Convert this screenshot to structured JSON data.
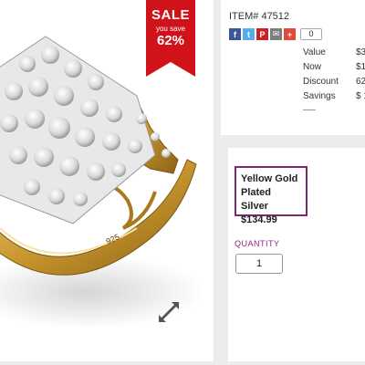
{
  "sale": {
    "title": "SALE",
    "subtitle": "you save",
    "percent": "62%",
    "ribbon_color": "#d0121b"
  },
  "icons": {
    "expand": "expand-arrows-icon",
    "share": [
      "facebook-icon",
      "twitter-icon",
      "pinterest-icon",
      "email-icon",
      "google-plus-icon"
    ]
  },
  "product": {
    "item_number": "ITEM# 47512",
    "share_count": "0",
    "share_letters": [
      "f",
      "t",
      "P",
      "✉",
      "+"
    ],
    "share_colors": [
      "#3b5998",
      "#55acee",
      "#cb2027",
      "#7d7d7d",
      "#dd4b39"
    ]
  },
  "pricing": {
    "rows": [
      {
        "label": "Value",
        "value": "$3"
      },
      {
        "label": "Now",
        "value": "$1"
      },
      {
        "label": "Discount",
        "value": "62"
      },
      {
        "label": "Savings",
        "value": "$ 1"
      }
    ]
  },
  "variant": {
    "line1": "Yellow Gold",
    "line2": "Plated Silver",
    "price": "$134.99",
    "border_color": "#7a2a6e"
  },
  "quantity": {
    "label": "QUANTITY",
    "value": "1"
  }
}
